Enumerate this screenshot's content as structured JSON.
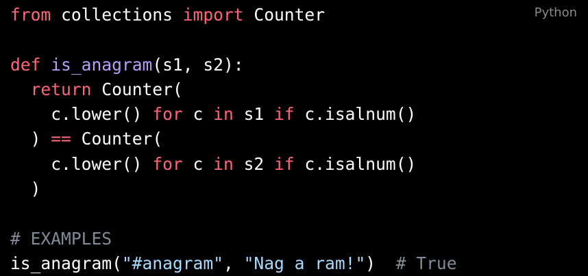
{
  "language_label": "Python",
  "colors": {
    "background": "#000000",
    "keyword": "#ff6478",
    "function": "#b79ffa",
    "string": "#a6daff",
    "comment": "#7f8c98",
    "text": "#ffffff",
    "label": "#8a8a8a"
  },
  "lines": [
    [
      {
        "t": "kw",
        "v": "from"
      },
      {
        "t": "tx",
        "v": " collections "
      },
      {
        "t": "kw",
        "v": "import"
      },
      {
        "t": "tx",
        "v": " Counter"
      }
    ],
    [],
    [
      {
        "t": "kw",
        "v": "def"
      },
      {
        "t": "tx",
        "v": " "
      },
      {
        "t": "fn",
        "v": "is_anagram"
      },
      {
        "t": "tx",
        "v": "(s1, s2):"
      }
    ],
    [
      {
        "t": "tx",
        "v": "  "
      },
      {
        "t": "kw",
        "v": "return"
      },
      {
        "t": "tx",
        "v": " Counter("
      }
    ],
    [
      {
        "t": "tx",
        "v": "    c.lower() "
      },
      {
        "t": "kw",
        "v": "for"
      },
      {
        "t": "tx",
        "v": " c "
      },
      {
        "t": "kw",
        "v": "in"
      },
      {
        "t": "tx",
        "v": " s1 "
      },
      {
        "t": "kw",
        "v": "if"
      },
      {
        "t": "tx",
        "v": " c.isalnum()"
      }
    ],
    [
      {
        "t": "tx",
        "v": "  ) "
      },
      {
        "t": "kw",
        "v": "=="
      },
      {
        "t": "tx",
        "v": " Counter("
      }
    ],
    [
      {
        "t": "tx",
        "v": "    c.lower() "
      },
      {
        "t": "kw",
        "v": "for"
      },
      {
        "t": "tx",
        "v": " c "
      },
      {
        "t": "kw",
        "v": "in"
      },
      {
        "t": "tx",
        "v": " s2 "
      },
      {
        "t": "kw",
        "v": "if"
      },
      {
        "t": "tx",
        "v": " c.isalnum()"
      }
    ],
    [
      {
        "t": "tx",
        "v": "  )"
      }
    ],
    [],
    [
      {
        "t": "cm",
        "v": "# EXAMPLES"
      }
    ],
    [
      {
        "t": "tx",
        "v": "is_anagram("
      },
      {
        "t": "str",
        "v": "\"#anagram\""
      },
      {
        "t": "tx",
        "v": ", "
      },
      {
        "t": "str",
        "v": "\"Nag a ram!\""
      },
      {
        "t": "tx",
        "v": ")  "
      },
      {
        "t": "cm",
        "v": "# True"
      }
    ]
  ]
}
